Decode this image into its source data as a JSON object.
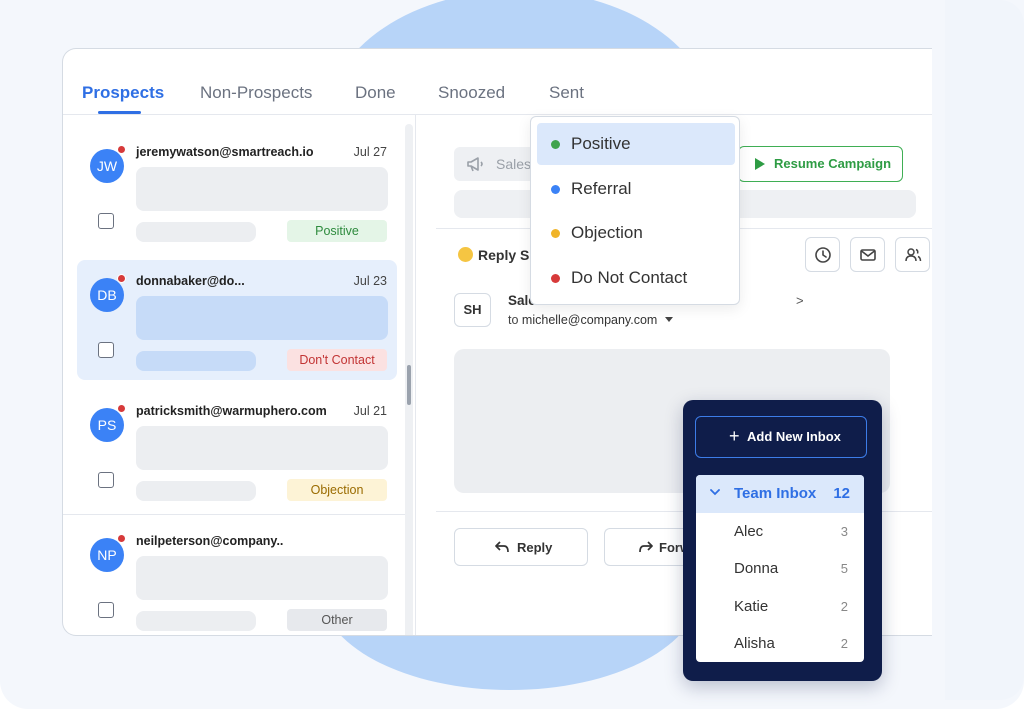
{
  "tabs": [
    "Prospects",
    "Non-Prospects",
    "Done",
    "Snoozed",
    "Sent"
  ],
  "active_tab": "Prospects",
  "messages": [
    {
      "initials": "JW",
      "email": "jeremywatson@smartreach.io",
      "date": "Jul 27",
      "category": "Positive",
      "selected": false
    },
    {
      "initials": "DB",
      "email": "donnabaker@do...",
      "date": "Jul 23",
      "category": "Don't Contact",
      "selected": true
    },
    {
      "initials": "PS",
      "email": "patricksmith@warmuphero.com",
      "date": "Jul 21",
      "category": "Objection",
      "selected": false
    },
    {
      "initials": "NP",
      "email": "neilpeterson@company..",
      "date": "",
      "category": "Other",
      "selected": false
    }
  ],
  "badge_colors": {
    "Positive": {
      "bg": "#e4f5e7",
      "fg": "#2e8b3e"
    },
    "Don't Contact": {
      "bg": "#fbe1e1",
      "fg": "#c23434"
    },
    "Objection": {
      "bg": "#fdf3d6",
      "fg": "#9a6b00"
    },
    "Other": {
      "bg": "#e7e9ed",
      "fg": "#555555"
    }
  },
  "detail": {
    "campaign_label": "Sales",
    "resume_button": "Resume Campaign",
    "reply_section_label": "Reply S",
    "sender_initials": "SH",
    "sender_name": "Sale",
    "sender_suffix": ">",
    "to_prefix": "to",
    "to_address": "michelle@company.com",
    "reply_button": "Reply",
    "forward_button": "Forw"
  },
  "category_dropdown": {
    "items": [
      {
        "label": "Positive",
        "color": "#3fa34d",
        "active": true
      },
      {
        "label": "Referral",
        "color": "#3b82f6",
        "active": false
      },
      {
        "label": "Objection",
        "color": "#f0b429",
        "active": false
      },
      {
        "label": "Do Not Contact",
        "color": "#d73a3a",
        "active": false
      }
    ]
  },
  "inbox_panel": {
    "add_button": "Add New Inbox",
    "team": {
      "name": "Team Inbox",
      "count": "12"
    },
    "members": [
      {
        "name": "Alec",
        "count": "3"
      },
      {
        "name": "Donna",
        "count": "5"
      },
      {
        "name": "Katie",
        "count": "2"
      },
      {
        "name": "Alisha",
        "count": "2"
      }
    ]
  }
}
